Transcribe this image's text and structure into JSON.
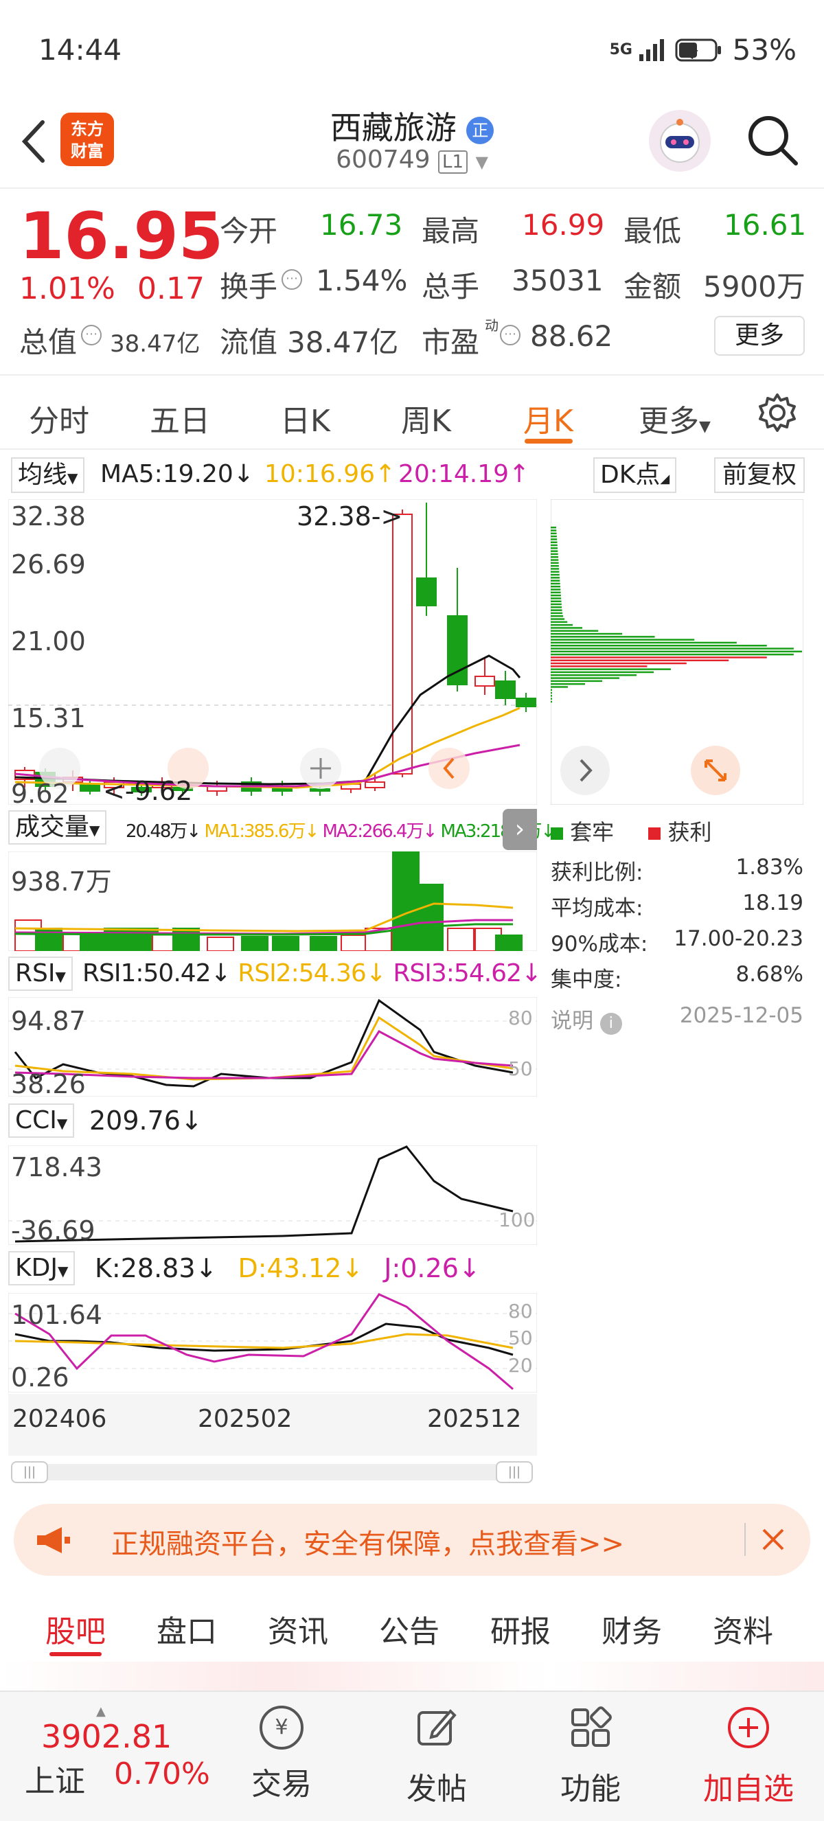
{
  "status_bar": {
    "time": "14:44",
    "network": "5G",
    "battery": "53%"
  },
  "header": {
    "logo_line1": "东方",
    "logo_line2": "财富",
    "title": "西藏旅游",
    "badge": "正",
    "code": "600749",
    "level": "L1"
  },
  "quote": {
    "price": "16.95",
    "change_pct": "1.01%",
    "change": "0.17",
    "open_label": "今开",
    "open": "16.73",
    "high_label": "最高",
    "high": "16.99",
    "low_label": "最低",
    "low": "16.61",
    "turnover_label": "换手",
    "turnover": "1.54%",
    "volume_label": "总手",
    "volume": "35031",
    "amount_label": "金额",
    "amount": "5900万",
    "mktcap_label": "总值",
    "mktcap": "38.47亿",
    "float_label": "流值",
    "float": "38.47亿",
    "pe_label": "市盈",
    "pe_sup": "动",
    "pe": "88.62",
    "more_button": "更多"
  },
  "period_tabs": [
    "分时",
    "五日",
    "日K",
    "周K",
    "月K",
    "更多"
  ],
  "active_tab": "月K",
  "ma_bar": {
    "selector": "均线",
    "ma5": "MA5:19.20↓",
    "ma10": "10:16.96↑",
    "ma20": "20:14.19↑",
    "dk": "DK点",
    "fq": "前复权"
  },
  "kline": {
    "y_labels": [
      "32.38",
      "26.69",
      "21.00",
      "15.31",
      "9.62"
    ],
    "max_annot": "32.38->",
    "min_annot": "<-9.62"
  },
  "volume": {
    "selector": "成交量",
    "v": "20.48万↓",
    "ma1": "MA1:385.6万↓",
    "ma2": "MA2:266.4万↓",
    "ma3": "MA3:218.8万↓",
    "y_label": "938.7万"
  },
  "rsi": {
    "selector": "RSI",
    "rsi1": "RSI1:50.42↓",
    "rsi2": "RSI2:54.36↓",
    "rsi3": "RSI3:54.62↓",
    "y_top": "94.87",
    "y_bottom": "38.26",
    "ref80": "80",
    "ref50": "50"
  },
  "cci": {
    "selector": "CCI",
    "value": "209.76↓",
    "y_top": "718.43",
    "y_bottom": "-36.69",
    "ref100": "100"
  },
  "kdj": {
    "selector": "KDJ",
    "k": "K:28.83↓",
    "d": "D:43.12↓",
    "j": "J:0.26↓",
    "y_top": "101.64",
    "y_bottom": "0.26",
    "ref80": "80",
    "ref50": "50",
    "ref20": "20"
  },
  "x_axis": [
    "202406",
    "202502",
    "202512"
  ],
  "chip": {
    "legend_trapped": "套牢",
    "legend_profit": "获利",
    "rows": [
      {
        "label": "获利比例:",
        "value": "1.83%"
      },
      {
        "label": "平均成本:",
        "value": "18.19"
      },
      {
        "label": "90%成本:",
        "value": "17.00-20.23"
      },
      {
        "label": "集中度:",
        "value": "8.68%"
      }
    ],
    "note_label": "说明",
    "date": "2025-12-05"
  },
  "banner": {
    "text": "正规融资平台，安全有保障，点我查看>>"
  },
  "bottom_tabs": [
    "股吧",
    "盘口",
    "资讯",
    "公告",
    "研报",
    "财务",
    "资料"
  ],
  "footer": {
    "index_value": "3902.81",
    "index_name": "上证",
    "index_change": "0.70%",
    "trade": "交易",
    "post": "发帖",
    "func": "功能",
    "add": "加自选",
    "trade_icon_text": "¥"
  },
  "colors": {
    "up": "#e3232c",
    "down": "#18a018",
    "accent": "#f0701a",
    "ma10": "#f0b400",
    "ma20": "#cc1fa8"
  }
}
